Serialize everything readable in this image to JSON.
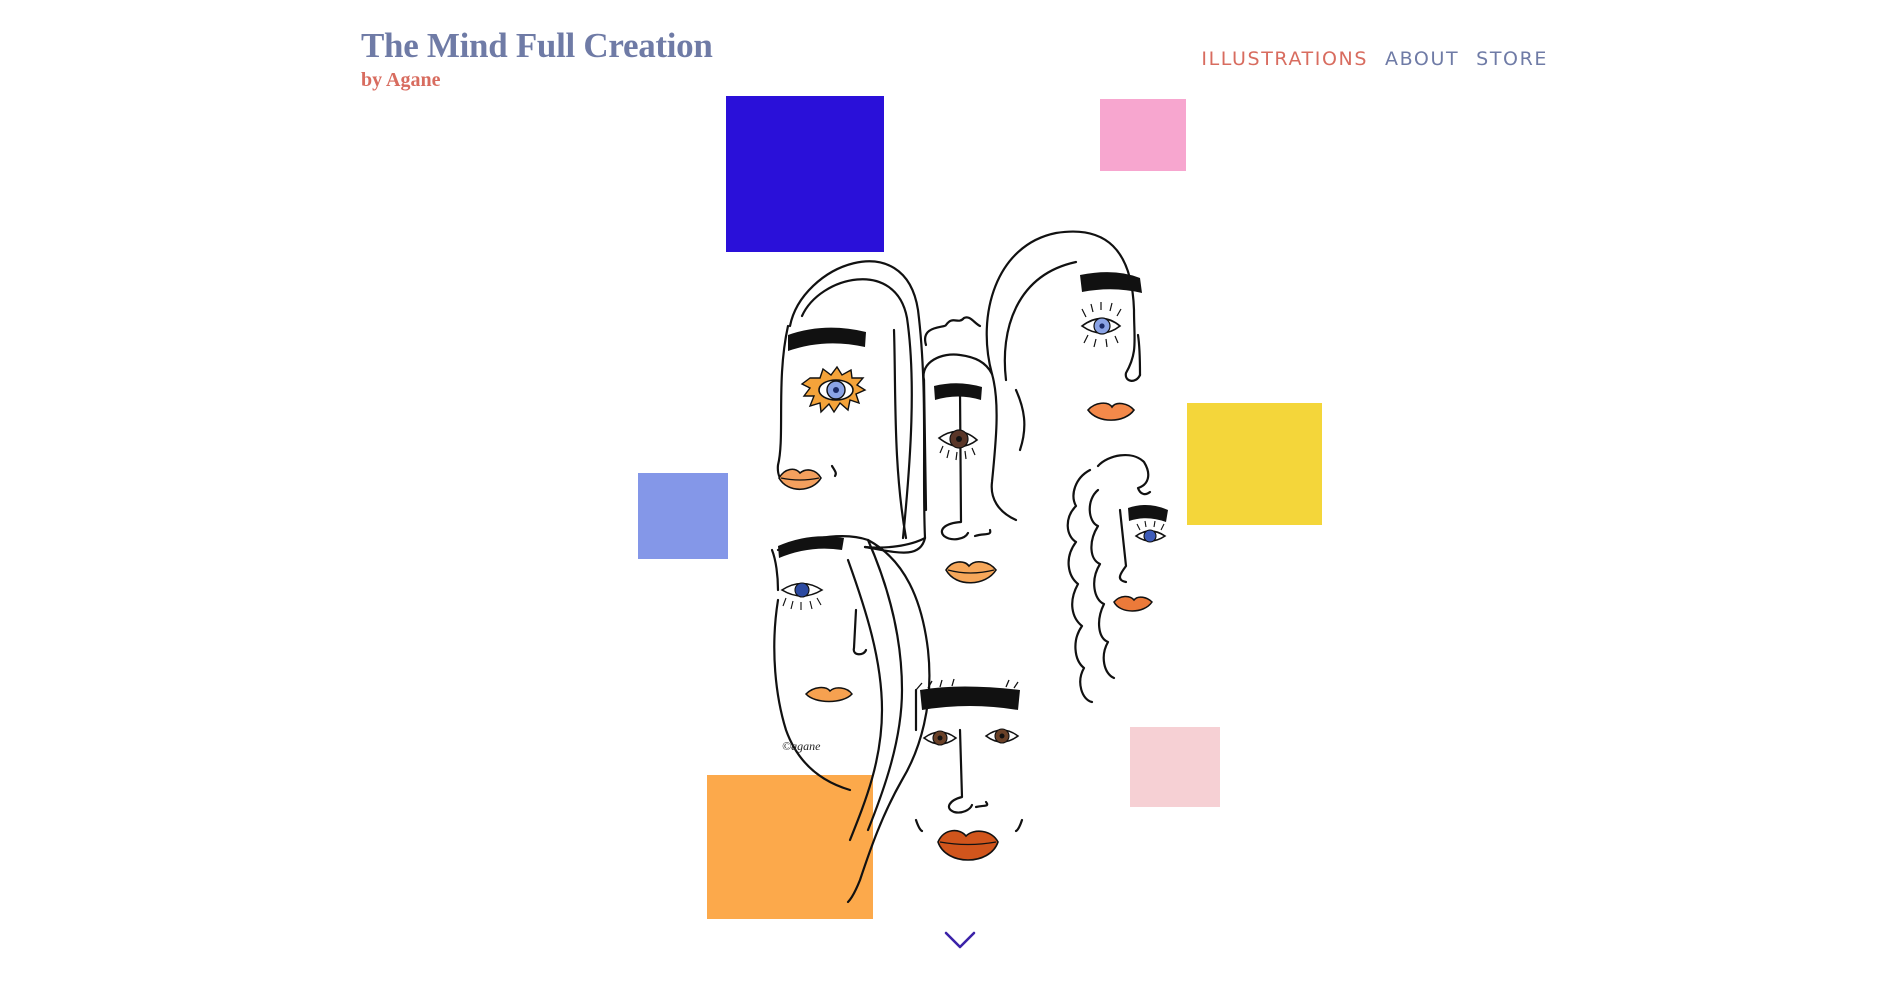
{
  "brand": {
    "title": "The Mind Full Creation",
    "subtitle": "by Agane"
  },
  "nav": {
    "items": [
      {
        "label": "ILLUSTRATIONS",
        "active": true
      },
      {
        "label": "ABOUT",
        "active": false
      },
      {
        "label": "STORE",
        "active": false
      }
    ]
  },
  "hero": {
    "artwork_signature": "©agane",
    "icons": [
      "faces-illustration",
      "chevron-down-icon"
    ]
  },
  "colors": {
    "title": "#6f7ba6",
    "accent": "#d86c5f",
    "square_blue": "#2a10d9",
    "square_pink": "#f7a6cf",
    "square_periwinkle": "#8497e8",
    "square_yellow": "#f4d63a",
    "square_orange": "#fca94b",
    "square_light_pink": "#f6d0d4",
    "chevron": "#3b22a8"
  }
}
